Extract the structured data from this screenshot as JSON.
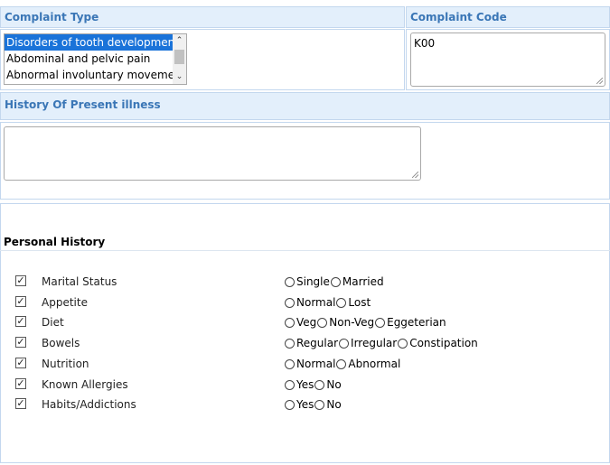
{
  "complaint_type": {
    "header": "Complaint Type",
    "options": [
      {
        "label": "Disorders of tooth development",
        "selected": true
      },
      {
        "label": "Abdominal and pelvic pain",
        "selected": false
      },
      {
        "label": "Abnormal involuntary movements",
        "selected": false
      }
    ]
  },
  "complaint_code": {
    "header": "Complaint Code",
    "value": "K00"
  },
  "history": {
    "header": "History Of Present illness",
    "value": ""
  },
  "personal_history": {
    "title": "Personal History",
    "rows": [
      {
        "label": "Marital Status",
        "checked": true,
        "options": [
          "Single",
          "Married"
        ]
      },
      {
        "label": "Appetite",
        "checked": true,
        "options": [
          "Normal",
          "Lost"
        ]
      },
      {
        "label": "Diet",
        "checked": true,
        "options": [
          "Veg",
          "Non-Veg",
          "Eggeterian"
        ]
      },
      {
        "label": "Bowels",
        "checked": true,
        "options": [
          "Regular",
          "Irregular",
          "Constipation"
        ]
      },
      {
        "label": "Nutrition",
        "checked": true,
        "options": [
          "Normal",
          "Abnormal"
        ]
      },
      {
        "label": "Known Allergies",
        "checked": true,
        "options": [
          "Yes",
          "No"
        ]
      },
      {
        "label": "Habits/Addictions",
        "checked": true,
        "options": [
          "Yes",
          "No"
        ]
      }
    ]
  },
  "colors": {
    "header_bg": "#e3effb",
    "header_text": "#3a76b6",
    "selection": "#1a73d9"
  }
}
